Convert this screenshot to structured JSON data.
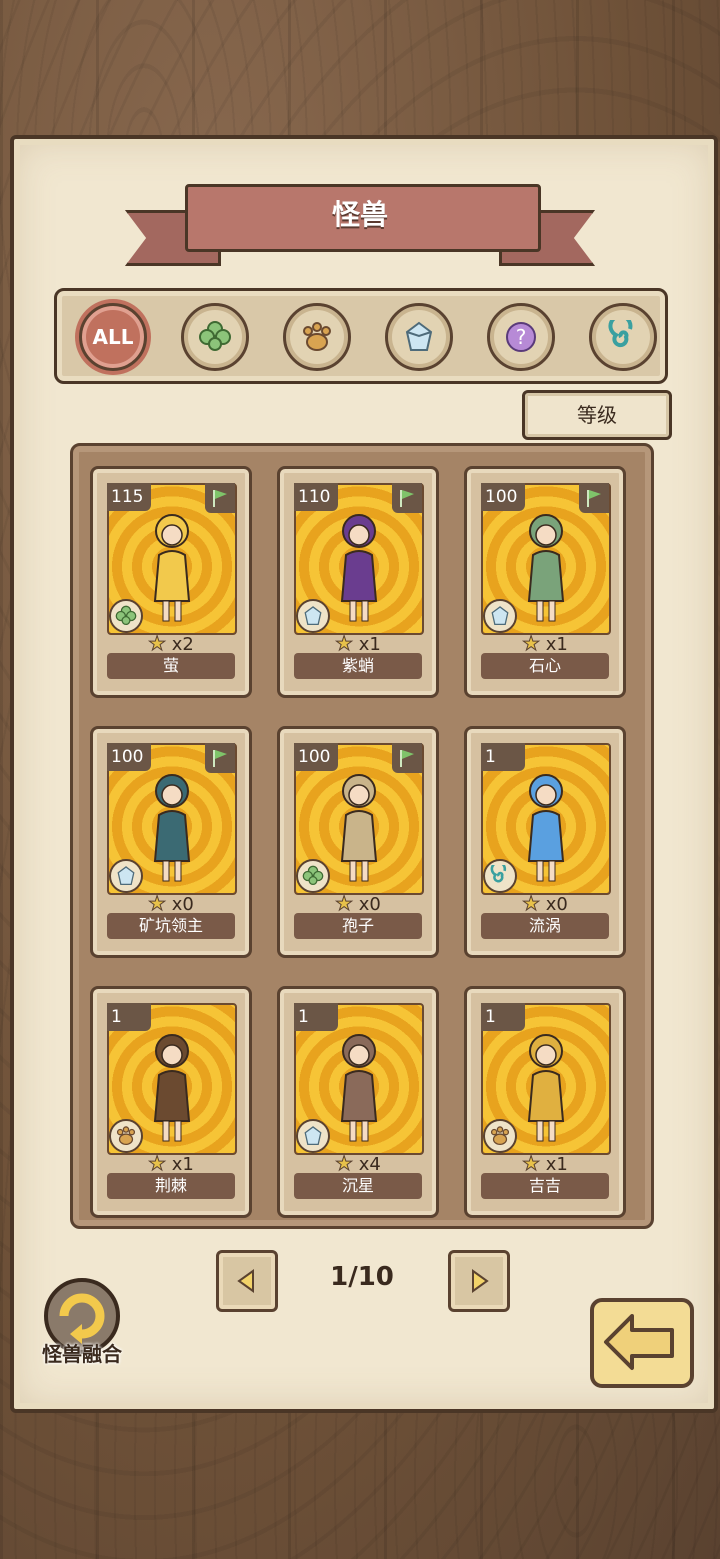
{
  "header": {
    "title": "怪兽"
  },
  "filters": [
    {
      "label": "ALL",
      "icon": "all-icon",
      "active": true
    },
    {
      "label": "",
      "icon": "clover-icon",
      "active": false
    },
    {
      "label": "",
      "icon": "paw-icon",
      "active": false
    },
    {
      "label": "",
      "icon": "crystal-icon",
      "active": false
    },
    {
      "label": "",
      "icon": "question-icon",
      "active": false
    },
    {
      "label": "",
      "icon": "spiral-icon",
      "active": false
    }
  ],
  "sort": {
    "label": "等级"
  },
  "cards": [
    {
      "level": "115",
      "count": "x2",
      "name": "萤",
      "type_icon": "clover-icon",
      "flag": true,
      "color": "#f2c94c"
    },
    {
      "level": "110",
      "count": "x1",
      "name": "紫蛸",
      "type_icon": "crystal-icon",
      "flag": true,
      "color": "#6a3d8f"
    },
    {
      "level": "100",
      "count": "x1",
      "name": "石心",
      "type_icon": "crystal-icon",
      "flag": true,
      "color": "#7aa37a"
    },
    {
      "level": "100",
      "count": "x0",
      "name": "矿坑领主",
      "type_icon": "crystal-icon",
      "flag": true,
      "color": "#3b6a73"
    },
    {
      "level": "100",
      "count": "x0",
      "name": "孢子",
      "type_icon": "clover-icon",
      "flag": true,
      "color": "#c9b48a"
    },
    {
      "level": "1",
      "count": "x0",
      "name": "流涡",
      "type_icon": "spiral-icon",
      "flag": false,
      "color": "#5aa0e0"
    },
    {
      "level": "1",
      "count": "x1",
      "name": "荆棘",
      "type_icon": "paw-icon",
      "flag": false,
      "color": "#6b4a30"
    },
    {
      "level": "1",
      "count": "x4",
      "name": "沉星",
      "type_icon": "crystal-icon",
      "flag": false,
      "color": "#8a6a5a"
    },
    {
      "level": "1",
      "count": "x1",
      "name": "吉吉",
      "type_icon": "paw-icon",
      "flag": false,
      "color": "#e0b040"
    }
  ],
  "pagination": {
    "text": "1/10"
  },
  "fusion": {
    "label": "怪兽融合"
  }
}
